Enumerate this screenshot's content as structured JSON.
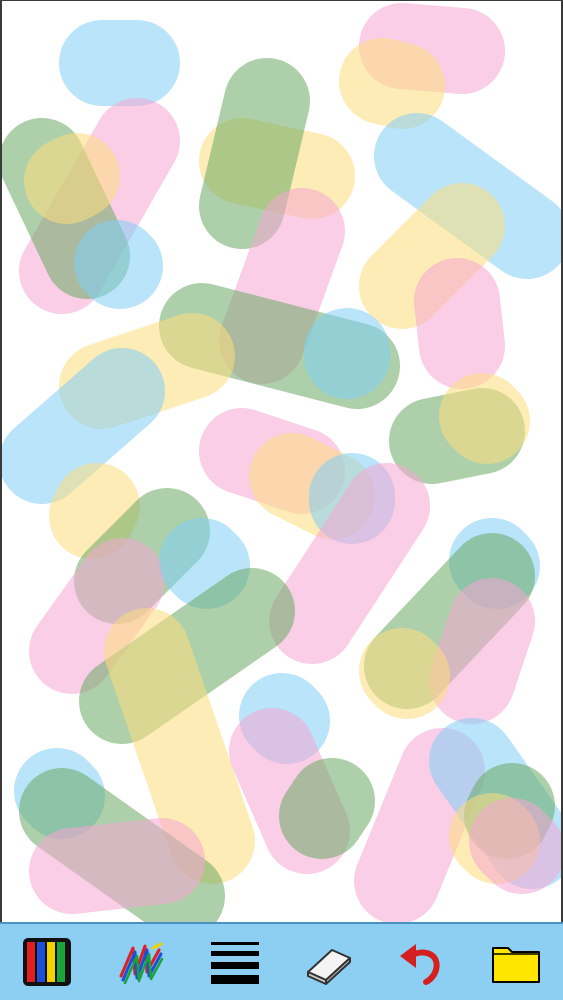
{
  "toolbar": {
    "background": "#8ccff2",
    "tools": [
      {
        "name": "color-palette",
        "icon": "color-bars-icon"
      },
      {
        "name": "brush",
        "icon": "brush-scribble-icon"
      },
      {
        "name": "line-width",
        "icon": "line-width-icon"
      },
      {
        "name": "eraser",
        "icon": "eraser-icon"
      },
      {
        "name": "undo",
        "icon": "undo-arrow-icon"
      },
      {
        "name": "open",
        "icon": "folder-icon"
      }
    ]
  },
  "palette": {
    "blue": "#7fcdf5",
    "pink": "#f6a6d2",
    "yellow": "#fddd7c",
    "green": "#6aa964"
  },
  "strokes": [
    {
      "color": "blue",
      "points": [
        [
          100,
          62
        ],
        [
          135,
          62
        ]
      ]
    },
    {
      "color": "pink",
      "points": [
        [
          135,
          140
        ],
        [
          60,
          270
        ]
      ]
    },
    {
      "color": "green",
      "points": [
        [
          40,
          160
        ],
        [
          85,
          255
        ]
      ]
    },
    {
      "color": "yellow",
      "points": [
        [
          75,
          175
        ],
        [
          65,
          180
        ]
      ]
    },
    {
      "color": "blue",
      "points": [
        [
          118,
          265
        ],
        [
          115,
          262
        ]
      ]
    },
    {
      "color": "yellow",
      "points": [
        [
          240,
          160
        ],
        [
          310,
          175
        ]
      ]
    },
    {
      "color": "green",
      "points": [
        [
          265,
          100
        ],
        [
          240,
          205
        ]
      ]
    },
    {
      "color": "pink",
      "points": [
        [
          300,
          230
        ],
        [
          260,
          340
        ]
      ]
    },
    {
      "color": "pink",
      "points": [
        [
          400,
          45
        ],
        [
          460,
          50
        ]
      ]
    },
    {
      "color": "yellow",
      "points": [
        [
          400,
          85
        ],
        [
          380,
          80
        ]
      ]
    },
    {
      "color": "blue",
      "points": [
        [
          415,
          155
        ],
        [
          525,
          235
        ]
      ]
    },
    {
      "color": "yellow",
      "points": [
        [
          460,
          225
        ],
        [
          400,
          285
        ]
      ]
    },
    {
      "color": "pink",
      "points": [
        [
          455,
          300
        ],
        [
          460,
          345
        ]
      ]
    },
    {
      "color": "green",
      "points": [
        [
          200,
          325
        ],
        [
          355,
          365
        ]
      ]
    },
    {
      "color": "blue",
      "points": [
        [
          345,
          350
        ],
        [
          345,
          355
        ]
      ]
    },
    {
      "color": "yellow",
      "points": [
        [
          190,
          355
        ],
        [
          100,
          385
        ]
      ]
    },
    {
      "color": "blue",
      "points": [
        [
          120,
          390
        ],
        [
          40,
          460
        ]
      ]
    },
    {
      "color": "green",
      "points": [
        [
          430,
          440
        ],
        [
          480,
          430
        ]
      ]
    },
    {
      "color": "yellow",
      "points": [
        [
          480,
          415
        ],
        [
          485,
          420
        ]
      ]
    },
    {
      "color": "pink",
      "points": [
        [
          240,
          450
        ],
        [
          300,
          470
        ]
      ]
    },
    {
      "color": "yellow",
      "points": [
        [
          290,
          475
        ],
        [
          330,
          495
        ]
      ]
    },
    {
      "color": "blue",
      "points": [
        [
          350,
          500
        ],
        [
          350,
          495
        ]
      ]
    },
    {
      "color": "pink",
      "points": [
        [
          385,
          505
        ],
        [
          310,
          620
        ]
      ]
    },
    {
      "color": "yellow",
      "points": [
        [
          95,
          505
        ],
        [
          90,
          515
        ]
      ]
    },
    {
      "color": "green",
      "points": [
        [
          165,
          530
        ],
        [
          115,
          580
        ]
      ]
    },
    {
      "color": "pink",
      "points": [
        [
          120,
          580
        ],
        [
          70,
          650
        ]
      ]
    },
    {
      "color": "blue",
      "points": [
        [
          200,
          560
        ],
        [
          205,
          565
        ]
      ]
    },
    {
      "color": "green",
      "points": [
        [
          250,
          610
        ],
        [
          120,
          700
        ]
      ]
    },
    {
      "color": "yellow",
      "points": [
        [
          145,
          650
        ],
        [
          210,
          840
        ]
      ]
    },
    {
      "color": "blue",
      "points": [
        [
          490,
          560
        ],
        [
          495,
          565
        ]
      ]
    },
    {
      "color": "green",
      "points": [
        [
          490,
          575
        ],
        [
          405,
          665
        ]
      ]
    },
    {
      "color": "pink",
      "points": [
        [
          490,
          620
        ],
        [
          470,
          680
        ]
      ]
    },
    {
      "color": "yellow",
      "points": [
        [
          400,
          670
        ],
        [
          405,
          675
        ]
      ]
    },
    {
      "color": "blue",
      "points": [
        [
          280,
          715
        ],
        [
          285,
          720
        ]
      ]
    },
    {
      "color": "pink",
      "points": [
        [
          270,
          750
        ],
        [
          305,
          830
        ]
      ]
    },
    {
      "color": "green",
      "points": [
        [
          330,
          800
        ],
        [
          320,
          815
        ]
      ]
    },
    {
      "color": "pink",
      "points": [
        [
          440,
          770
        ],
        [
          395,
          880
        ]
      ]
    },
    {
      "color": "blue",
      "points": [
        [
          470,
          760
        ],
        [
          530,
          845
        ]
      ]
    },
    {
      "color": "green",
      "points": [
        [
          510,
          805
        ],
        [
          505,
          815
        ]
      ]
    },
    {
      "color": "yellow",
      "points": [
        [
          490,
          835
        ],
        [
          495,
          840
        ]
      ]
    },
    {
      "color": "pink",
      "points": [
        [
          510,
          840
        ],
        [
          520,
          850
        ]
      ]
    },
    {
      "color": "blue",
      "points": [
        [
          55,
          790
        ],
        [
          60,
          795
        ]
      ]
    },
    {
      "color": "green",
      "points": [
        [
          60,
          810
        ],
        [
          180,
          895
        ]
      ]
    },
    {
      "color": "pink",
      "points": [
        [
          70,
          870
        ],
        [
          160,
          860
        ]
      ]
    }
  ]
}
